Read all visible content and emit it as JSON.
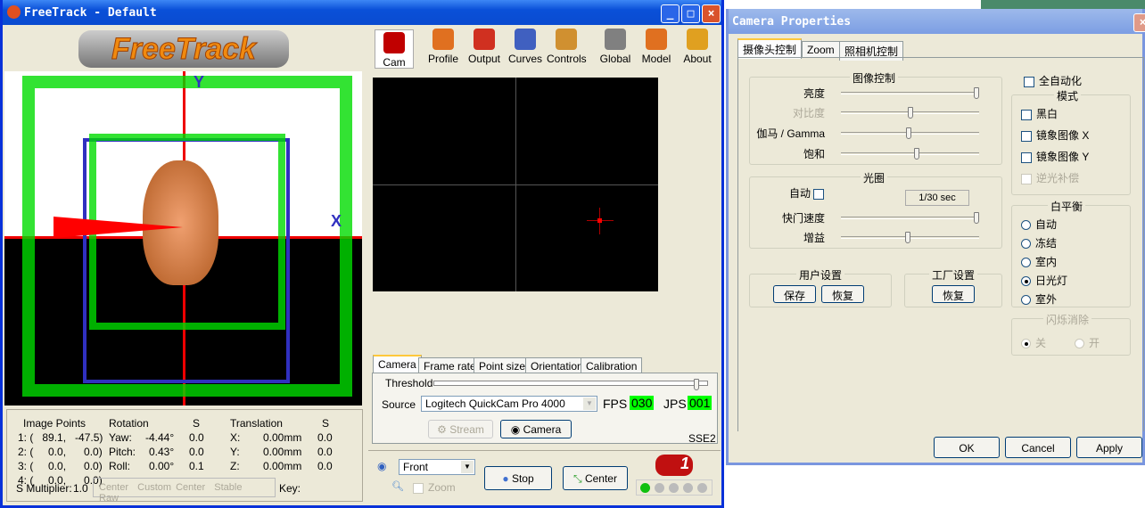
{
  "main_window": {
    "title": "FreeTrack - Default",
    "logo": "FreeTrack",
    "toolbar": [
      {
        "label": "Cam",
        "icon": "camera-icon",
        "color": "#c00000"
      },
      {
        "label": "Profile",
        "icon": "profile-icon",
        "color": "#e07020"
      },
      {
        "label": "Output",
        "icon": "output-icon",
        "color": "#d03020"
      },
      {
        "label": "Curves",
        "icon": "curves-icon",
        "color": "#4060c0"
      },
      {
        "label": "Controls",
        "icon": "controls-icon",
        "color": "#d09030"
      },
      {
        "label": "Global",
        "icon": "global-icon",
        "color": "#808080"
      },
      {
        "label": "Model",
        "icon": "model-icon",
        "color": "#e07020"
      },
      {
        "label": "About",
        "icon": "about-icon",
        "color": "#e0a020"
      }
    ],
    "axes": {
      "y": "Y",
      "x": "X"
    },
    "info": {
      "image_points_header": "Image Points",
      "points": [
        "1: (   89.1,   -47.5)",
        "2: (     0.0,      0.0)",
        "3: (     0.0,      0.0)",
        "4: (     0.0,      0.0)"
      ],
      "rotation_header": "Rotation",
      "s_header": "S",
      "translation_header": "Translation",
      "rotation": [
        {
          "label": "Yaw:",
          "value": "-4.44°",
          "s": "0.0"
        },
        {
          "label": "Pitch:",
          "value": "0.43°",
          "s": "0.0"
        },
        {
          "label": "Roll:",
          "value": "0.00°",
          "s": "0.1"
        }
      ],
      "translation": [
        {
          "label": "X:",
          "value": "0.00mm",
          "s": "0.0"
        },
        {
          "label": "Y:",
          "value": "0.00mm",
          "s": "0.0"
        },
        {
          "label": "Z:",
          "value": "0.00mm",
          "s": "0.0"
        }
      ],
      "s_multiplier_label": "S Multiplier:",
      "s_multiplier": "1.0",
      "key_label": "Key:",
      "modes": [
        "Center",
        "Custom Center",
        "Stable",
        "Raw"
      ]
    },
    "tabs": [
      "Camera",
      "Frame rate",
      "Point size",
      "Orientation",
      "Calibration"
    ],
    "threshold_label": "Threshold",
    "threshold_value": 0.97,
    "source_label": "Source",
    "source_value": "Logitech QuickCam Pro 4000",
    "fps_label": "FPS",
    "fps": "030",
    "jps_label": "JPS",
    "jps": "001",
    "stream_label": "Stream",
    "camera_label": "Camera",
    "sse": "SSE2",
    "view_select": "Front",
    "zoom_label": "Zoom",
    "stop_label": "Stop",
    "center_label": "Center",
    "badge": "1"
  },
  "dialog": {
    "title": "Camera Properties",
    "tabs": [
      "摄像头控制",
      "Zoom",
      "照相机控制"
    ],
    "image_group": "图像控制",
    "sliders": [
      {
        "label": "亮度",
        "value": 1.0,
        "disabled": false
      },
      {
        "label": "对比度",
        "value": 0.5,
        "disabled": true
      },
      {
        "label": "伽马 / Gamma",
        "value": 0.49,
        "disabled": false
      },
      {
        "label": "饱和",
        "value": 0.55,
        "disabled": false
      }
    ],
    "aperture_group": "光圈",
    "auto_label": "自动",
    "shutter_value": "1/30 sec",
    "shutter_label": "快门速度",
    "shutter_pos": 1.0,
    "gain_label": "增益",
    "gain_pos": 0.48,
    "user_group": "用户设置",
    "save": "保存",
    "restore": "恢复",
    "factory_group": "工厂设置",
    "factory_restore": "恢复",
    "full_auto": "全自动化",
    "mode_group": "模式",
    "modes": [
      "黑白",
      "镜象图像 X",
      "镜象图像 Y",
      "逆光补偿"
    ],
    "wb_group": "白平衡",
    "wb": [
      "自动",
      "冻结",
      "室内",
      "日光灯",
      "室外"
    ],
    "wb_selected": 3,
    "flicker_group": "闪烁消除",
    "flicker": [
      "关",
      "开"
    ],
    "ok": "OK",
    "cancel": "Cancel",
    "apply": "Apply"
  }
}
